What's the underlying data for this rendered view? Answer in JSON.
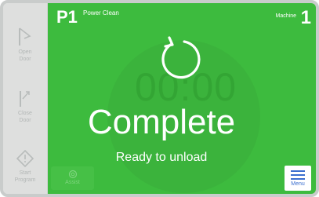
{
  "sidebar": {
    "buttons": [
      {
        "label_line1": "Open",
        "label_line2": "Door",
        "icon": "open-door-icon"
      },
      {
        "label_line1": "Close",
        "label_line2": "Door",
        "icon": "close-door-icon"
      },
      {
        "label_line1": "Start",
        "label_line2": "Program",
        "icon": "start-program-icon"
      }
    ]
  },
  "header": {
    "program_code": "P1",
    "program_name": "Power Clean",
    "machine_label": "Machine",
    "machine_number": "1"
  },
  "main": {
    "background_timer": "00:00",
    "status": "Complete",
    "substatus": "Ready to unload",
    "cycle_icon": "cycle-complete-icon",
    "assist_label": "Assist",
    "menu_label": "Menu"
  },
  "colors": {
    "screen_green": "#3dbb3e",
    "menu_blue": "#3b6fcf",
    "frame": "#c9cccb"
  }
}
